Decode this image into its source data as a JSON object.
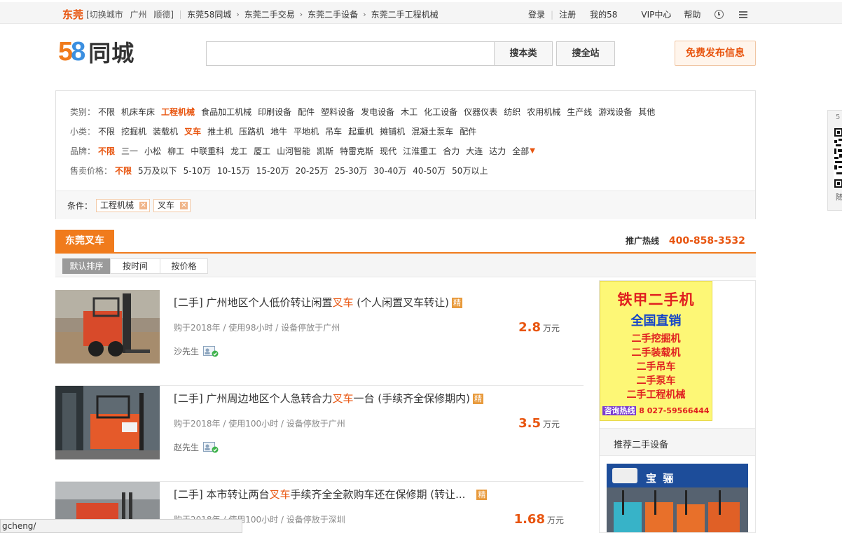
{
  "topbar": {
    "city": "东莞",
    "switch_label": "[切换城市",
    "nearby": [
      "广州",
      "顺德]"
    ],
    "breadcrumbs": [
      "东莞58同城",
      "东莞二手交易",
      "东莞二手设备",
      "东莞二手工程机械"
    ],
    "links": [
      "登录",
      "注册",
      "我的58",
      "VIP中心",
      "帮助"
    ]
  },
  "header": {
    "logo_digits": [
      "5",
      "8"
    ],
    "logo_text": "同城",
    "search_value": "",
    "search_category_label": "搜本类",
    "search_all_label": "搜全站",
    "post_label": "免费发布信息"
  },
  "filter": {
    "rows": [
      {
        "label": "类别：",
        "options": [
          {
            "text": "不限",
            "on": false
          },
          {
            "text": "机床车床",
            "on": false
          },
          {
            "text": "工程机械",
            "on": true
          },
          {
            "text": "食品加工机械",
            "on": false
          },
          {
            "text": "印刷设备",
            "on": false
          },
          {
            "text": "配件",
            "on": false
          },
          {
            "text": "塑料设备",
            "on": false
          },
          {
            "text": "发电设备",
            "on": false
          },
          {
            "text": "木工",
            "on": false
          },
          {
            "text": "化工设备",
            "on": false
          },
          {
            "text": "仪器仪表",
            "on": false
          },
          {
            "text": "纺织",
            "on": false
          },
          {
            "text": "农用机械",
            "on": false
          },
          {
            "text": "生产线",
            "on": false
          },
          {
            "text": "游戏设备",
            "on": false
          },
          {
            "text": "其他",
            "on": false
          }
        ]
      },
      {
        "label": "小类：",
        "options": [
          {
            "text": "不限",
            "on": false
          },
          {
            "text": "挖掘机",
            "on": false
          },
          {
            "text": "装载机",
            "on": false
          },
          {
            "text": "叉车",
            "on": true
          },
          {
            "text": "推土机",
            "on": false
          },
          {
            "text": "压路机",
            "on": false
          },
          {
            "text": "地牛",
            "on": false
          },
          {
            "text": "平地机",
            "on": false
          },
          {
            "text": "吊车",
            "on": false
          },
          {
            "text": "起重机",
            "on": false
          },
          {
            "text": "摊铺机",
            "on": false
          },
          {
            "text": "混凝土泵车",
            "on": false
          },
          {
            "text": "配件",
            "on": false
          }
        ]
      },
      {
        "label": "品牌：",
        "options": [
          {
            "text": "不限",
            "on": true
          },
          {
            "text": "三一",
            "on": false
          },
          {
            "text": "小松",
            "on": false
          },
          {
            "text": "柳工",
            "on": false
          },
          {
            "text": "中联重科",
            "on": false
          },
          {
            "text": "龙工",
            "on": false
          },
          {
            "text": "厦工",
            "on": false
          },
          {
            "text": "山河智能",
            "on": false
          },
          {
            "text": "凯斯",
            "on": false
          },
          {
            "text": "特雷克斯",
            "on": false
          },
          {
            "text": "现代",
            "on": false
          },
          {
            "text": "江淮重工",
            "on": false
          },
          {
            "text": "合力",
            "on": false
          },
          {
            "text": "大连",
            "on": false
          },
          {
            "text": "达力",
            "on": false
          },
          {
            "text": "全部",
            "on": false
          }
        ]
      },
      {
        "label": "售卖价格：",
        "options": [
          {
            "text": "不限",
            "on": true
          },
          {
            "text": "5万及以下",
            "on": false
          },
          {
            "text": "5-10万",
            "on": false
          },
          {
            "text": "10-15万",
            "on": false
          },
          {
            "text": "15-20万",
            "on": false
          },
          {
            "text": "20-25万",
            "on": false
          },
          {
            "text": "25-30万",
            "on": false
          },
          {
            "text": "30-40万",
            "on": false
          },
          {
            "text": "40-50万",
            "on": false
          },
          {
            "text": "50万以上",
            "on": false
          }
        ]
      }
    ],
    "brand_more_glyph": "▼",
    "conditions_label": "条件：",
    "conditions": [
      "工程机械",
      "叉车"
    ],
    "remove_glyph": "✕"
  },
  "list": {
    "tab_label": "东莞叉车",
    "hotline_label": "推广热线",
    "hotline_number": "400-858-3532",
    "sort_options": [
      {
        "text": "默认排序",
        "on": true
      },
      {
        "text": "按时间",
        "on": false
      },
      {
        "text": "按价格",
        "on": false
      }
    ],
    "items": [
      {
        "title_pre": "[二手] 广州地区个人低价转让闲置",
        "keyword": "叉车",
        "title_post": " (个人闲置叉车转让)",
        "badge": "精",
        "meta": "购于2018年 / 使用98小时 / 设备停放于广州",
        "seller": "沙先生",
        "price": "2.8",
        "unit": "万元"
      },
      {
        "title_pre": "[二手] 广州周边地区个人急转合力",
        "keyword": "叉车",
        "title_post": "一台 (手续齐全保修期内)",
        "badge": "精",
        "meta": "购于2018年 / 使用100小时 / 设备停放于广州",
        "seller": "赵先生",
        "price": "3.5",
        "unit": "万元"
      },
      {
        "title_pre": "[二手] 本市转让两台",
        "keyword": "叉车",
        "title_post": "手续齐全全款购车还在保修期 (转让...",
        "badge": "精",
        "meta": "购于2018年 / 使用100小时 / 设备停放于深圳",
        "seller": "",
        "price": "1.68",
        "unit": "万元"
      }
    ]
  },
  "sidebar": {
    "ad": {
      "title": "铁甲二手机",
      "subtitle": "全国直销",
      "lines": [
        "二手挖掘机",
        "二手装载机",
        "二手吊车",
        "二手泵车",
        "二手工程机械"
      ],
      "tel_label": "咨询热线",
      "tel": "8 027-59566444"
    },
    "recommend_title": "推荐二手设备",
    "shop_sign": "宝 骊"
  },
  "qr_strip": {
    "top": "5",
    "caption": "随"
  },
  "statusbar": {
    "url": "gcheng/"
  },
  "colors": {
    "accent": "#f07b1c",
    "keyword": "#e8550f",
    "link": "#333333"
  }
}
